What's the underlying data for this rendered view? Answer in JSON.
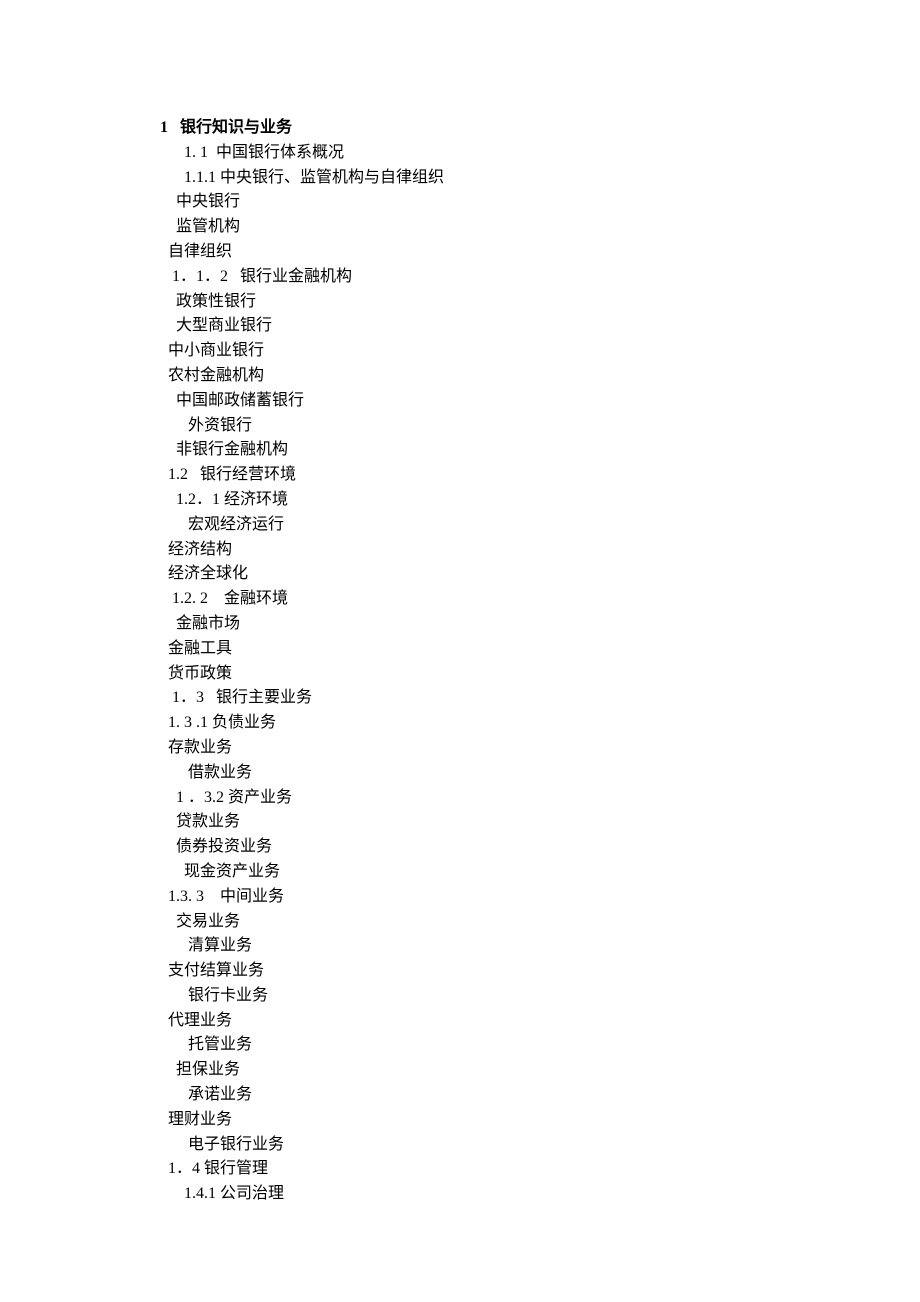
{
  "lines": [
    {
      "text": "1   银行知识与业务",
      "indent": 0,
      "bold": true
    },
    {
      "text": "1. 1  中国银行体系概况",
      "indent": 24
    },
    {
      "text": "1.1.1 中央银行、监管机构与自律组织",
      "indent": 24
    },
    {
      "text": "中央银行",
      "indent": 16
    },
    {
      "text": "监管机构",
      "indent": 16
    },
    {
      "text": "自律组织",
      "indent": 8
    },
    {
      "text": "1．1．2   银行业金融机构",
      "indent": 12
    },
    {
      "text": "政策性银行",
      "indent": 16
    },
    {
      "text": "大型商业银行",
      "indent": 16
    },
    {
      "text": "中小商业银行",
      "indent": 8
    },
    {
      "text": "农村金融机构",
      "indent": 8
    },
    {
      "text": "中国邮政储蓄银行",
      "indent": 16
    },
    {
      "text": "外资银行",
      "indent": 28
    },
    {
      "text": "非银行金融机构",
      "indent": 16
    },
    {
      "text": "1.2   银行经营环境",
      "indent": 8
    },
    {
      "text": "1.2．1 经济环境",
      "indent": 16
    },
    {
      "text": "宏观经济运行",
      "indent": 28
    },
    {
      "text": "经济结构",
      "indent": 8
    },
    {
      "text": "经济全球化",
      "indent": 8
    },
    {
      "text": "1.2. 2    金融环境",
      "indent": 12
    },
    {
      "text": "金融市场",
      "indent": 16
    },
    {
      "text": "金融工具",
      "indent": 8
    },
    {
      "text": "货币政策",
      "indent": 8
    },
    {
      "text": "1．3   银行主要业务",
      "indent": 12
    },
    {
      "text": "1. 3 .1 负债业务",
      "indent": 8
    },
    {
      "text": "存款业务",
      "indent": 8
    },
    {
      "text": "借款业务",
      "indent": 28
    },
    {
      "text": "1 ．3.2 资产业务",
      "indent": 16
    },
    {
      "text": "贷款业务",
      "indent": 16
    },
    {
      "text": "债券投资业务",
      "indent": 16
    },
    {
      "text": "现金资产业务",
      "indent": 24
    },
    {
      "text": "1.3. 3    中间业务",
      "indent": 8
    },
    {
      "text": "交易业务",
      "indent": 16
    },
    {
      "text": "清算业务",
      "indent": 28
    },
    {
      "text": "支付结算业务",
      "indent": 8
    },
    {
      "text": "银行卡业务",
      "indent": 28
    },
    {
      "text": "代理业务",
      "indent": 8
    },
    {
      "text": "托管业务",
      "indent": 28
    },
    {
      "text": "担保业务",
      "indent": 16
    },
    {
      "text": "承诺业务",
      "indent": 28
    },
    {
      "text": "理财业务",
      "indent": 8
    },
    {
      "text": "电子银行业务",
      "indent": 28
    },
    {
      "text": "1．4 银行管理",
      "indent": 8
    },
    {
      "text": "1.4.1 公司治理",
      "indent": 24
    }
  ]
}
